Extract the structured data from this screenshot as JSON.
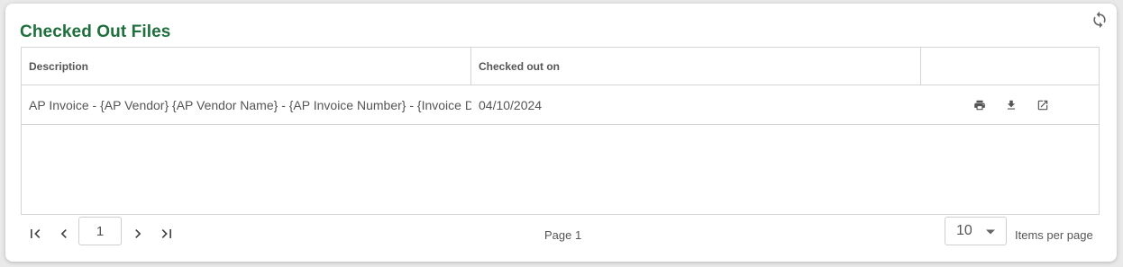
{
  "panel": {
    "title": "Checked Out Files",
    "refresh_icon": "refresh-icon"
  },
  "table": {
    "columns": [
      "Description",
      "Checked out on",
      ""
    ],
    "rows": [
      {
        "description": "AP Invoice - {AP Vendor} {AP Vendor Name} - {AP Invoice Number} - {Invoice Date}",
        "checked_out_on": "04/10/2024",
        "actions": [
          "print-icon",
          "download-icon",
          "open-in-new-icon"
        ]
      }
    ]
  },
  "pager": {
    "current_page": "1",
    "page_label": "Page 1",
    "page_size": "10",
    "items_per_page_label": "Items per page",
    "icons": [
      "first-page-icon",
      "previous-page-icon",
      "next-page-icon",
      "last-page-icon"
    ]
  },
  "colors": {
    "title": "#1f6f3d",
    "border": "#d5d5d5",
    "icon": "#555555"
  }
}
